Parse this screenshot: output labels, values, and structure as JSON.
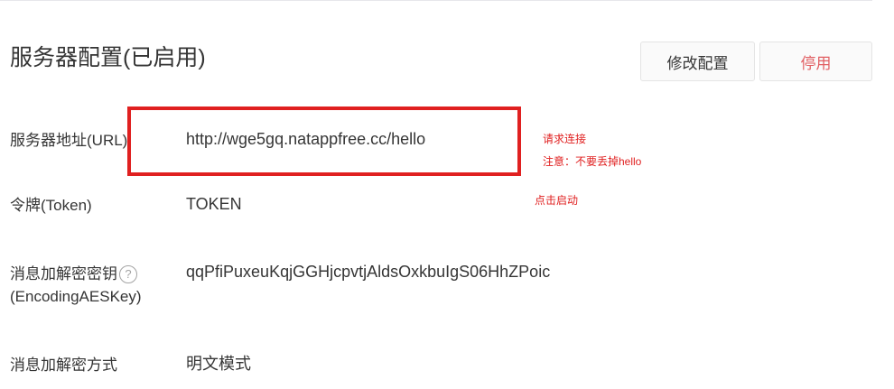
{
  "section": {
    "title": "服务器配置(已启用)",
    "edit_button": "修改配置",
    "stop_button": "停用"
  },
  "rows": [
    {
      "label": "服务器地址(URL)",
      "value": "http://wge5gq.natappfree.cc/hello"
    },
    {
      "label": "令牌(Token)",
      "value": "TOKEN"
    },
    {
      "label_line1": "消息加解密密钥",
      "label_line2": "(EncodingAESKey)",
      "value": "qqPfiPuxeuKqjGGHjcpvtjAldsOxkbuIgS06HhZPoic"
    },
    {
      "label": "消息加解密方式",
      "value": "明文模式"
    }
  ],
  "help_icon_glyph": "?",
  "annotations": {
    "url_note_1": "请求连接",
    "url_note_2": "注意：不要丢掉hello",
    "token_note": "点击启动"
  },
  "colors": {
    "annotation_red": "#e02020",
    "stop_button_text": "#e15f63"
  }
}
